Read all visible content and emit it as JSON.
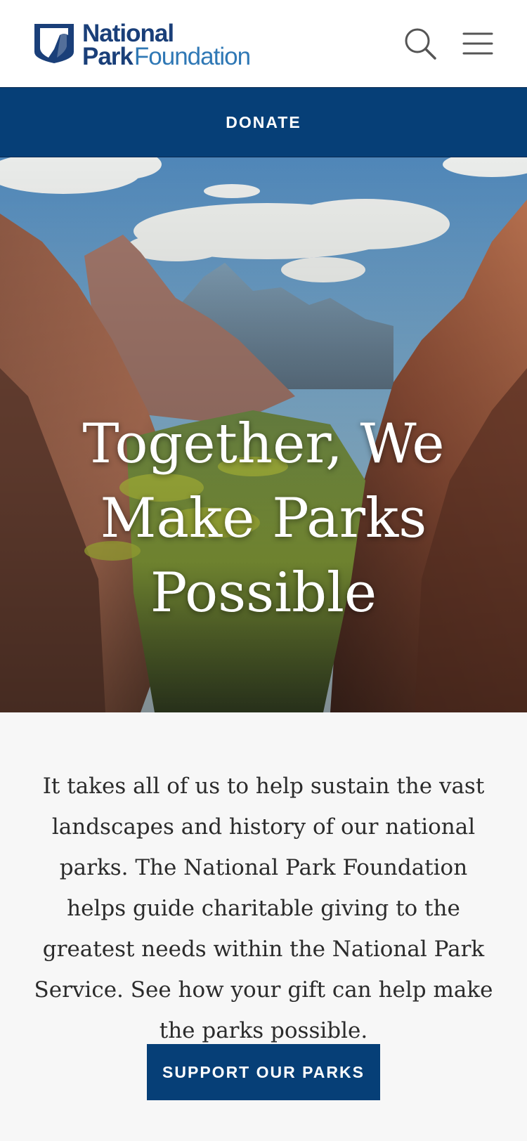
{
  "header": {
    "logo": {
      "line1": "National",
      "line2_bold": "Park",
      "line2_light": "Foundation"
    },
    "icons": {
      "search": "search-icon",
      "menu": "hamburger-menu-icon"
    }
  },
  "donate_bar": {
    "label": "DONATE"
  },
  "hero": {
    "title": "Together, We Make Parks Possible"
  },
  "intro": {
    "text": "It takes all of us to help sustain the vast landscapes and history of our national parks. The National Park Foundation helps guide charitable giving to the greatest needs within the National Park Service. See how your gift can help make the parks possible."
  },
  "cta": {
    "label": "SUPPORT OUR PARKS"
  },
  "colors": {
    "brand_navy": "#063f77",
    "logo_blue": "#2f78b5",
    "page_bg": "#f7f7f7"
  }
}
